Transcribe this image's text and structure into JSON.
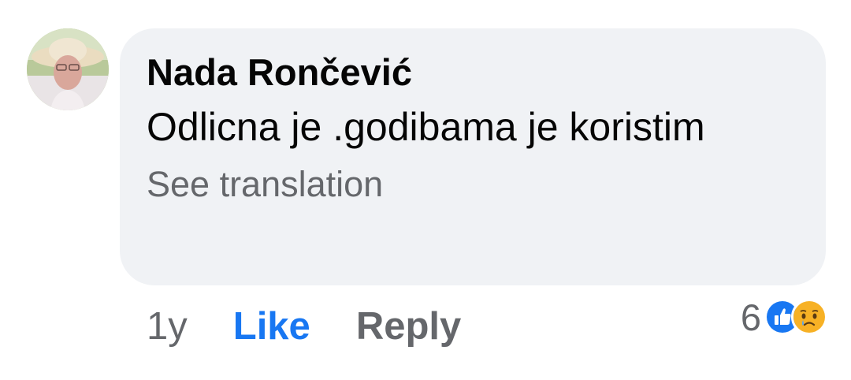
{
  "comment": {
    "author": "Nada Rončević",
    "text": "Odlicna je .godibama je koristim",
    "see_translation": "See translation",
    "age": "1y",
    "like_label": "Like",
    "reply_label": "Reply",
    "reaction_count": "6",
    "reactions": [
      "like-icon",
      "sad-icon"
    ]
  },
  "colors": {
    "bubble_bg": "#f0f2f5",
    "like_blue": "#1877f2",
    "secondary_text": "#65676b",
    "primary_text": "#050505",
    "sad_yellow": "#f7b125"
  }
}
